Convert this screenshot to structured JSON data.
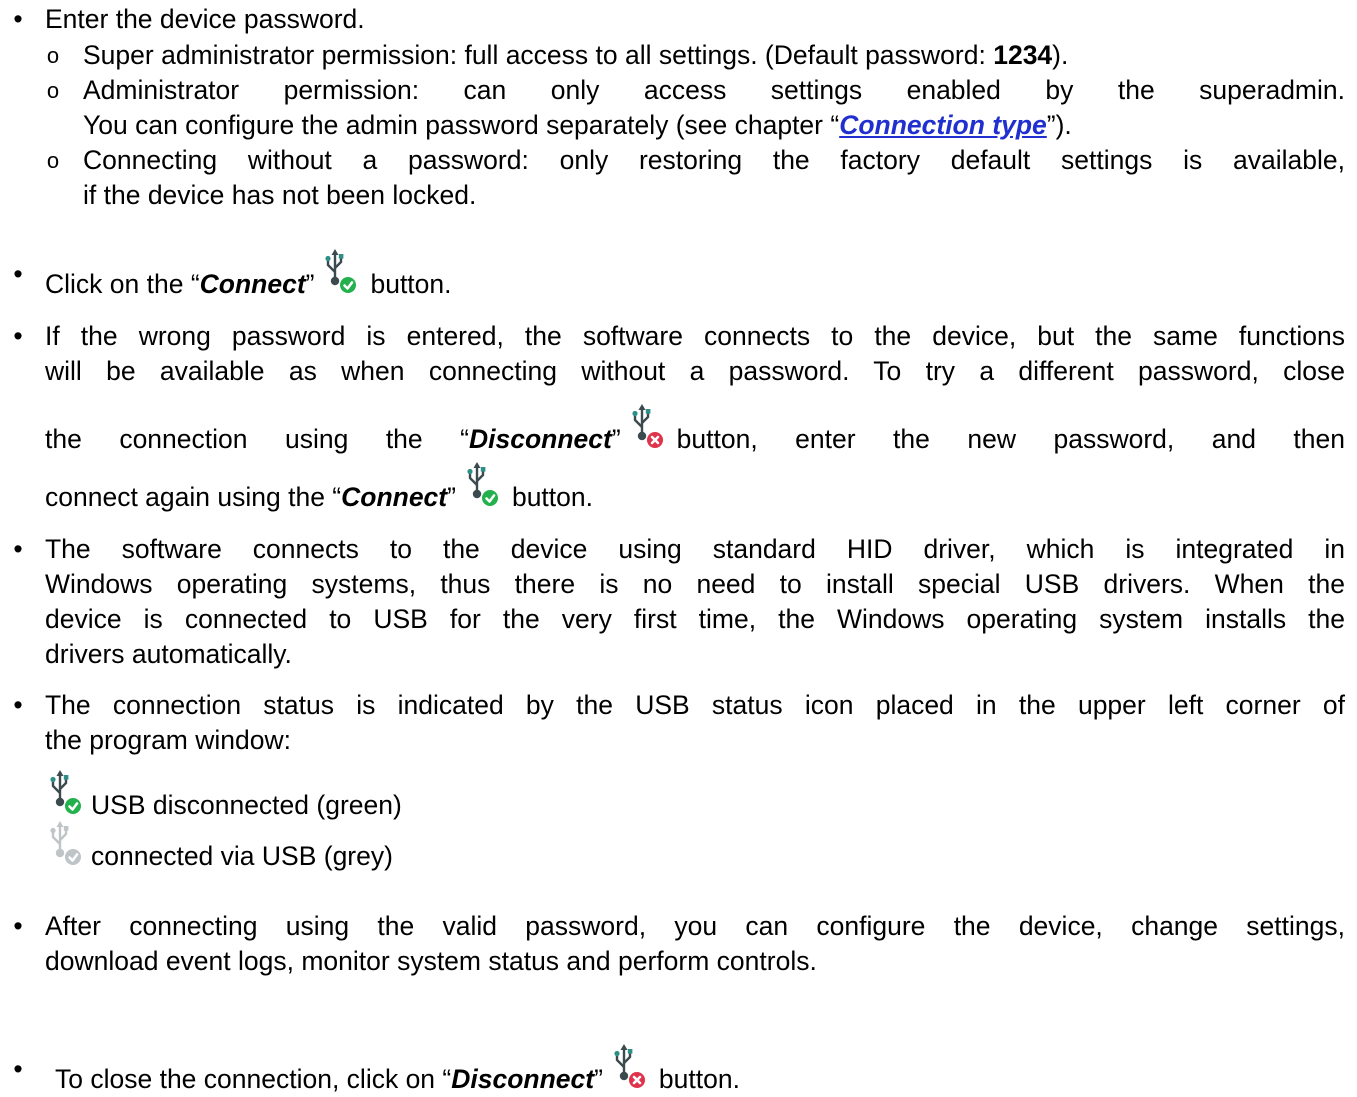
{
  "pw": {
    "text": "Enter the device password.",
    "sub": [
      {
        "pre": "Super administrator permission: full access to all settings. (Default password: ",
        "bold": "1234",
        "post": ")."
      },
      {
        "line1": "Administrator permission: can only access settings enabled by the superadmin.",
        "pre": "You can configure the admin password separately (see chapter “",
        "link": "Connection type",
        "post": "”)."
      },
      {
        "line1": "Connecting without a password: only restoring the factory default settings is available,",
        "line2": "if the device has not been locked."
      }
    ]
  },
  "connect": {
    "pre": "Click on the “",
    "bold": "Connect",
    "mid": "”",
    "post": "button."
  },
  "wrong": {
    "line1": "If the wrong password is entered, the software connects to the device, but the same functions",
    "line2": "will be available as when connecting without a password. To try a different password, close",
    "l3_pre": "the connection using the “",
    "l3_bold": "Disconnect",
    "l3_q": "”",
    "l3_post": "button, enter the new password, and then",
    "l4_pre": "connect again using the “",
    "l4_bold": "Connect",
    "l4_q": "”",
    "l4_post": "button."
  },
  "hid": {
    "line1": "The software connects to the device using standard HID driver, which is integrated in",
    "line2": "Windows operating systems, thus there is no need to install special USB drivers. When the",
    "line3": "device is connected to USB for the very first time, the Windows operating system installs the",
    "line4": "drivers automatically."
  },
  "status": {
    "line1": "The connection status is indicated by the USB status icon placed in the upper left corner of",
    "line2": "the program window:",
    "green_label": "USB disconnected (green)",
    "grey_label": "connected via USB (grey)"
  },
  "valid": {
    "line1": "After connecting using the valid password, you can configure the device, change settings,",
    "line2": "download event logs, monitor system status and perform controls."
  },
  "close": {
    "pre": "To close the connection, click on “",
    "bold": "Disconnect",
    "mid": "”",
    "post": "button."
  },
  "colors": {
    "link": "#1f2fd0",
    "usb_dark": "#3b4a4e",
    "usb_teal": "#2d8f86",
    "green": "#22b14c",
    "red": "#e0324a",
    "grey": "#bfc4c6"
  }
}
